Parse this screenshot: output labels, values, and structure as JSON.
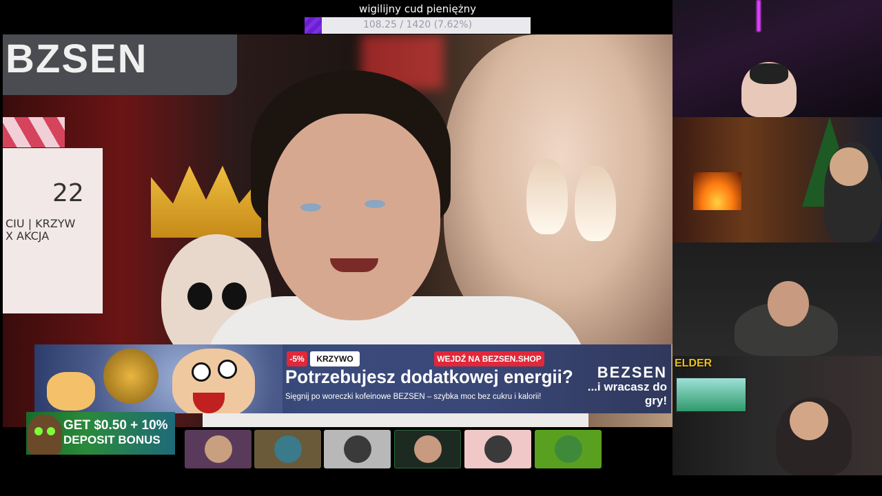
{
  "goal": {
    "title": "wigilijny cud pieniężny",
    "progress_text": "108.25 / 1420 (7.62%)",
    "current": 108.25,
    "target": 1420,
    "percent": 7.62,
    "fill_color": "#7b2fe0"
  },
  "main_stream": {
    "sign_text": "BZSEN",
    "clapper_number": "22",
    "clapper_line1": "CIU | KRZYW",
    "clapper_line2": "X  AKCJA"
  },
  "ad": {
    "discount": "-5%",
    "tag": "KRZYWO",
    "cta": "WEJDŹ NA BEZSEN.SHOP",
    "headline": "Potrzebujesz dodatkowej energii?",
    "subline": "Sięgnij po woreczki kofeinowe BEZSEN – szybka moc bez cukru i kalorii!",
    "brand": "BEZSEN",
    "brand_tagline": "...i wracasz do gry!",
    "accent_color": "#e0283a"
  },
  "bonus": {
    "line1": "GET $0.50 + 10%",
    "line2": "DEPOSIT BONUS"
  },
  "avatars": [
    {
      "name": "viewer-1",
      "color": "#5a3a5a"
    },
    {
      "name": "viewer-2",
      "color": "#6a5a3a"
    },
    {
      "name": "viewer-3",
      "color": "#b8b8b8"
    },
    {
      "name": "viewer-4",
      "color": "#1c2a22"
    },
    {
      "name": "viewer-5",
      "color": "#f0c8c8"
    },
    {
      "name": "viewer-6",
      "color": "#5aa020"
    }
  ],
  "side_cams": {
    "cam4_label": "ELDER"
  }
}
